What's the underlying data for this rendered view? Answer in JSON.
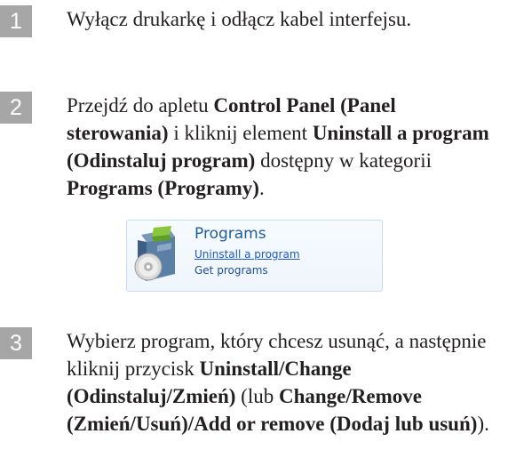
{
  "steps": [
    {
      "number": "1",
      "parts": [
        "Wyłącz drukarkę i odłącz kabel interfejsu."
      ]
    },
    {
      "number": "2",
      "parts": [
        "Przejdź do apletu ",
        "Control Panel (Panel sterowania)",
        " i kliknij element ",
        "Uninstall a program (Odinstaluj program)",
        " dostępny w kategorii ",
        "Programs (Programy)",
        "."
      ]
    },
    {
      "number": "3",
      "parts": [
        "Wybierz program, który chcesz usunąć, a następnie kliknij przycisk ",
        "Uninstall/Change (Odinstaluj/Zmień)",
        " (lub ",
        "Change/Remove (Zmień/Usuń)",
        "/",
        "Add or remove (Dodaj lub usuń)",
        ")."
      ]
    }
  ],
  "programs_panel": {
    "title": "Programs",
    "link_uninstall": "Uninstall a program",
    "link_get": "Get programs",
    "icon": "programs-installer-icon"
  },
  "colors": {
    "step_badge": "#a6a6a6",
    "panel_title": "#1e5c9b",
    "panel_link": "#1d59c8"
  }
}
